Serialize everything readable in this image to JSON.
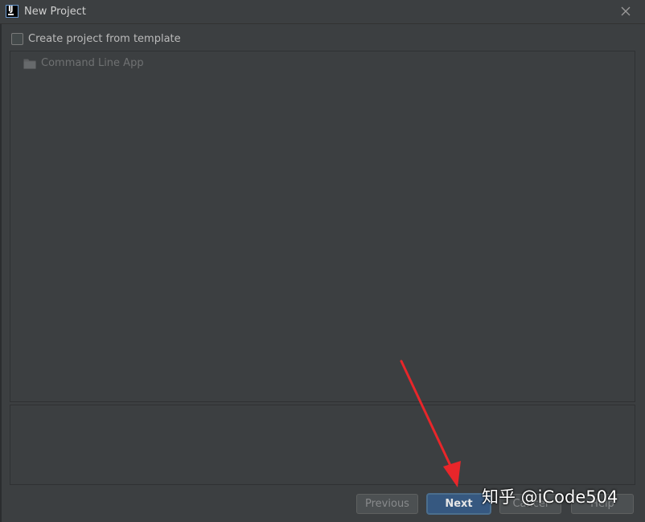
{
  "window": {
    "title": "New Project",
    "icon": "intellij-icon",
    "icon_text": "IJ"
  },
  "template_option": {
    "label": "Create project from template",
    "checked": false
  },
  "template_list": {
    "items": [
      {
        "label": "Command Line App",
        "icon": "folder-icon",
        "disabled": true
      }
    ]
  },
  "buttons": {
    "previous": "Previous",
    "next": "Next",
    "cancel": "Cancel",
    "help": "Help"
  },
  "watermark": "知乎 @iCode504",
  "colors": {
    "background": "#3c3f41",
    "primary_button": "#365880",
    "annotation_arrow": "#e8262a"
  }
}
